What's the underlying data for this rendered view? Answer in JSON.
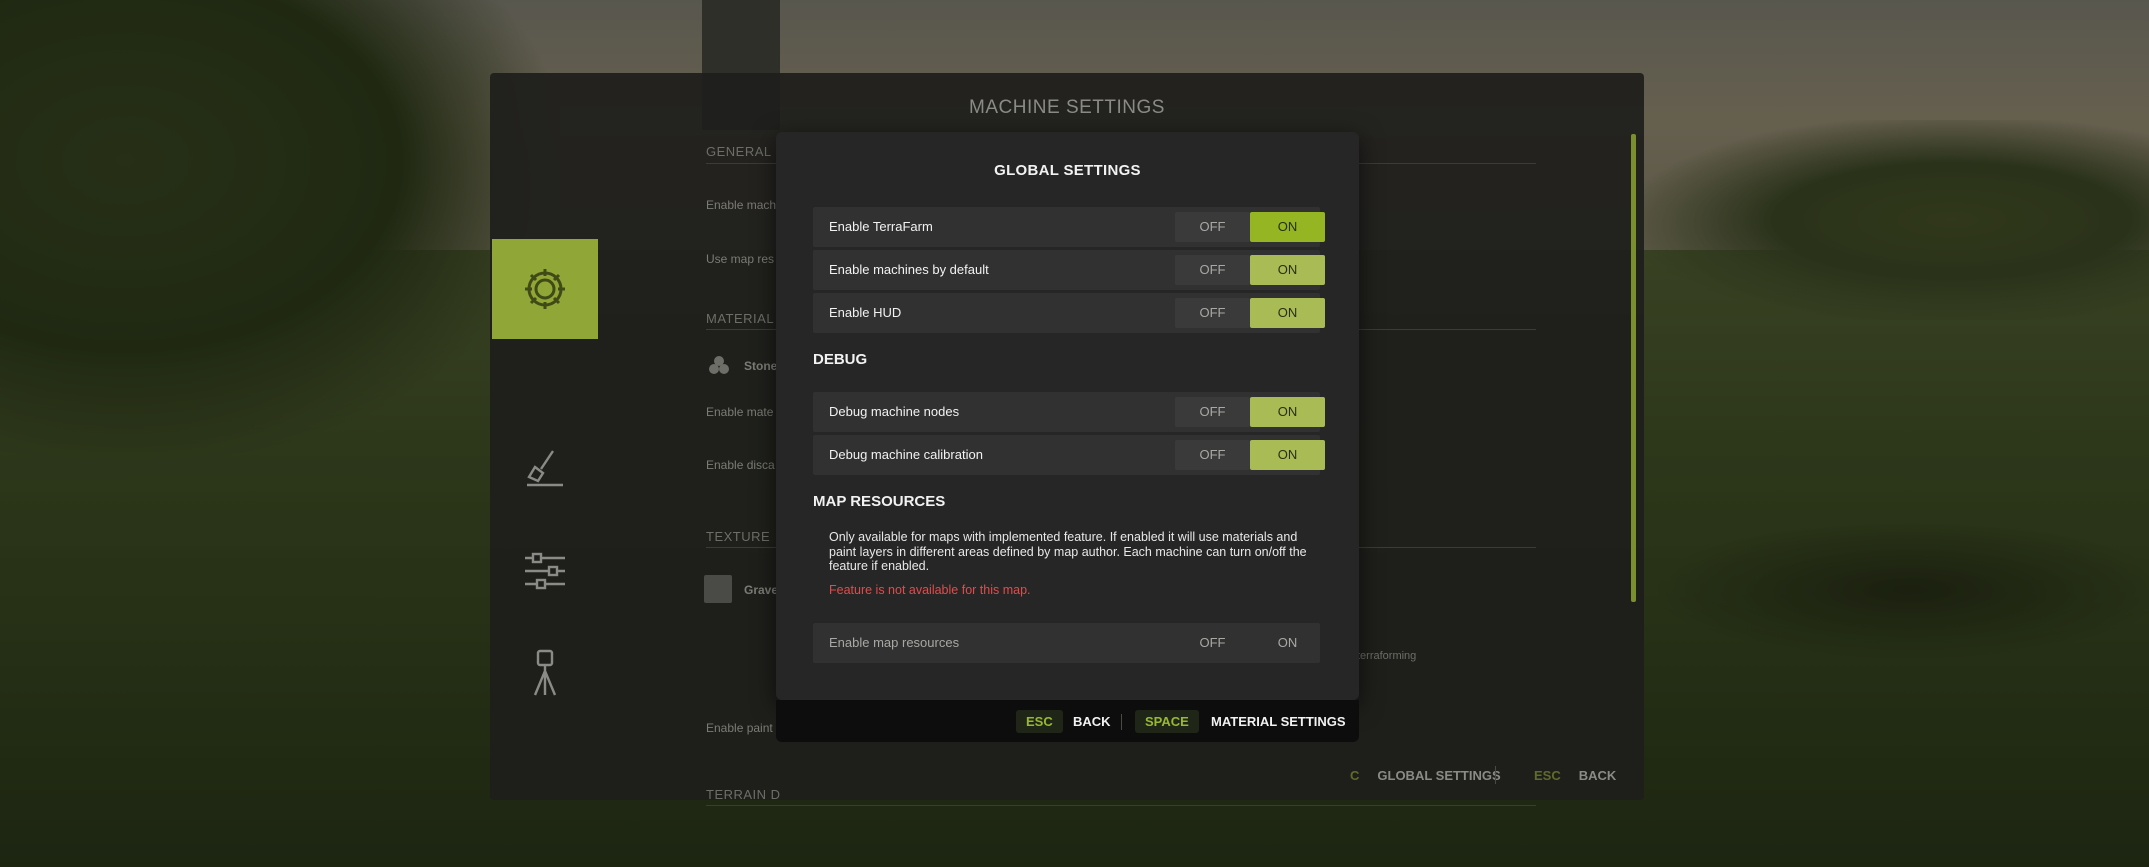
{
  "background_panel": {
    "title": "MACHINE SETTINGS",
    "tabs": [
      {
        "name": "gear-icon",
        "active": true
      },
      {
        "name": "shovel-icon",
        "active": false
      },
      {
        "name": "sliders-icon",
        "active": false
      },
      {
        "name": "survey-tripod-icon",
        "active": false
      }
    ],
    "sections": {
      "general": "GENERAL",
      "material": "MATERIAL",
      "texture": "TEXTURE",
      "terrain": "TERRAIN D"
    },
    "rows": {
      "enable_machine": "Enable mach",
      "use_map_resources": "Use map res",
      "stone": "Stone",
      "enable_material": "Enable mate",
      "enable_discharge": "Enable disca",
      "gravel": "Grave",
      "enable_paint": "Enable paint"
    },
    "terraforming_note": "terraforming",
    "footer": {
      "global_key": "C",
      "global_label": "GLOBAL SETTINGS",
      "back_key": "ESC",
      "back_label": "BACK"
    }
  },
  "dialog": {
    "title": "GLOBAL SETTINGS",
    "general_settings": [
      {
        "label": "Enable TerraFarm",
        "off": "OFF",
        "on": "ON",
        "value": "on"
      },
      {
        "label": "Enable machines by default",
        "off": "OFF",
        "on": "ON",
        "value": "on"
      },
      {
        "label": "Enable HUD",
        "off": "OFF",
        "on": "ON",
        "value": "on"
      }
    ],
    "debug_title": "DEBUG",
    "debug_settings": [
      {
        "label": "Debug machine nodes",
        "off": "OFF",
        "on": "ON",
        "value": "on"
      },
      {
        "label": "Debug machine calibration",
        "off": "OFF",
        "on": "ON",
        "value": "on"
      }
    ],
    "map_resources_title": "MAP RESOURCES",
    "map_resources_description": "Only available for maps with implemented feature. If enabled it will use materials and paint layers in different areas defined by map author. Each machine can turn on/off the feature if enabled.",
    "map_resources_warning": "Feature is not available for this map.",
    "map_resources_setting": {
      "label": "Enable map resources",
      "off": "OFF",
      "on": "ON",
      "value": "disabled"
    },
    "footer": {
      "back_key": "ESC",
      "back_label": "BACK",
      "material_key": "SPACE",
      "material_label": "MATERIAL SETTINGS"
    }
  },
  "colors": {
    "accent": "#95b522",
    "toggle_on": "#a8bb55",
    "warning": "#e34b4b",
    "dialog_bg": "#262626"
  }
}
